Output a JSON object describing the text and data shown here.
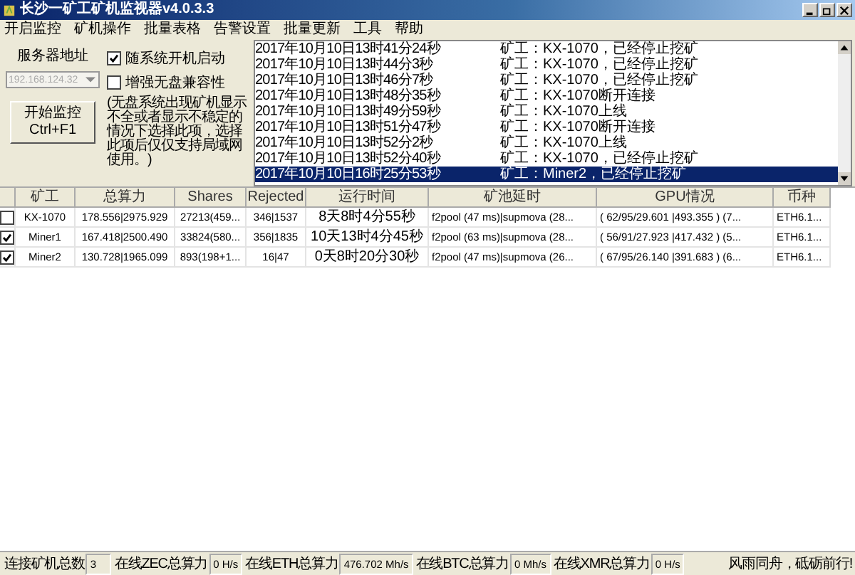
{
  "window": {
    "title": "长沙一矿工矿机监视器v4.0.3.3"
  },
  "menu": [
    "开启监控",
    "矿机操作",
    "批量表格",
    "告警设置",
    "批量更新",
    "工具",
    "帮助"
  ],
  "server": {
    "label": "服务器地址",
    "value": "192.168.124.32",
    "disabled": true
  },
  "start_button": {
    "label": "开始监控",
    "shortcut": "Ctrl+F1"
  },
  "options": [
    {
      "label": "随系统开机启动",
      "checked": true
    },
    {
      "label": "增强无盘兼容性",
      "checked": false
    }
  ],
  "note": "(无盘系统出现矿机显示不全或者显示不稳定的情况下选择此项，选择此项后仅仅支持局域网使用。)",
  "log": [
    {
      "time": "2017年10月10日13时41分24秒",
      "message": "矿工：KX-1070，已经停止挖矿",
      "selected": false
    },
    {
      "time": "2017年10月10日13时44分3秒",
      "message": "矿工：KX-1070，已经停止挖矿",
      "selected": false
    },
    {
      "time": "2017年10月10日13时46分7秒",
      "message": "矿工：KX-1070，已经停止挖矿",
      "selected": false
    },
    {
      "time": "2017年10月10日13时48分35秒",
      "message": "矿工：KX-1070断开连接",
      "selected": false
    },
    {
      "time": "2017年10月10日13时49分59秒",
      "message": "矿工：KX-1070上线",
      "selected": false
    },
    {
      "time": "2017年10月10日13时51分47秒",
      "message": "矿工：KX-1070断开连接",
      "selected": false
    },
    {
      "time": "2017年10月10日13时52分2秒",
      "message": "矿工：KX-1070上线",
      "selected": false
    },
    {
      "time": "2017年10月10日13时52分40秒",
      "message": "矿工：KX-1070，已经停止挖矿",
      "selected": false
    },
    {
      "time": "2017年10月10日16时25分53秒",
      "message": "矿工：Miner2，已经停止挖矿",
      "selected": true
    }
  ],
  "table": {
    "columns": [
      "矿工",
      "总算力",
      "Shares",
      "Rejected",
      "运行时间",
      "矿池延时",
      "GPU情况",
      "币种"
    ],
    "rows": [
      {
        "checked": false,
        "cells": [
          "KX-1070",
          "178.556|2975.929",
          "27213(459...",
          "346|1537",
          "8天8时4分55秒",
          "f2pool (47 ms)|supmova (28...",
          "( 62/95/29.601 |493.355 ) (7...",
          "ETH6.1..."
        ]
      },
      {
        "checked": true,
        "cells": [
          "Miner1",
          "167.418|2500.490",
          "33824(580...",
          "356|1835",
          "10天13时4分45秒",
          "f2pool (63 ms)|supmova (28...",
          "( 56/91/27.923 |417.432 ) (5...",
          "ETH6.1..."
        ]
      },
      {
        "checked": true,
        "cells": [
          "Miner2",
          "130.728|1965.099",
          "893(198+1...",
          "16|47",
          "0天8时20分30秒",
          "f2pool (47 ms)|supmova (26...",
          "( 67/95/26.140 |391.683 ) (6...",
          "ETH6.1..."
        ]
      }
    ]
  },
  "status_bar": [
    {
      "label": "连接矿机总数",
      "value": "3"
    },
    {
      "label": "在线ZEC总算力",
      "value": "0 H/s"
    },
    {
      "label": "在线ETH总算力",
      "value": "476.702 Mh/s"
    },
    {
      "label": "在线BTC总算力",
      "value": "0 Mh/s"
    },
    {
      "label": "在线XMR总算力",
      "value": "0 H/s"
    }
  ],
  "slogan": "风雨同舟，砥砺前行!"
}
